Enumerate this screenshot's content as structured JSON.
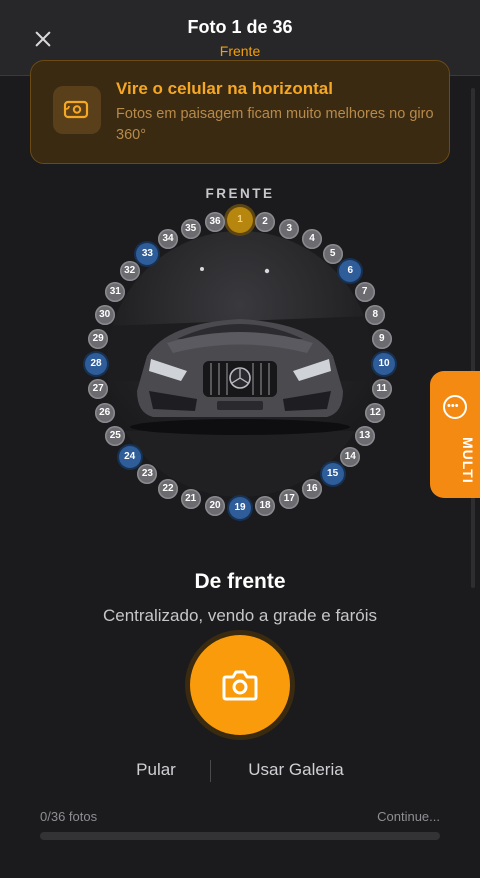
{
  "header": {
    "title": "Foto 1 de 36",
    "subtitle": "Frente"
  },
  "tip": {
    "title": "Vire o celular na horizontal",
    "text": "Fotos em paisagem ficam muito melhores no giro 360°"
  },
  "rotation": {
    "label": "FRENTE",
    "total_positions": 36,
    "current_position": 1,
    "highlighted_positions": [
      6,
      10,
      15,
      19,
      24,
      28,
      33
    ],
    "positions": [
      "1",
      "2",
      "3",
      "4",
      "5",
      "6",
      "7",
      "8",
      "9",
      "10",
      "11",
      "12",
      "13",
      "14",
      "15",
      "16",
      "17",
      "18",
      "19",
      "20",
      "21",
      "22",
      "23",
      "24",
      "25",
      "26",
      "27",
      "28",
      "29",
      "30",
      "31",
      "32",
      "33",
      "34",
      "35",
      "36"
    ]
  },
  "side_button": {
    "label": "MULTI",
    "icon": "chat-bubble-icon"
  },
  "step": {
    "title": "De frente",
    "description": "Centralizado, vendo a grade e faróis"
  },
  "capture_button": {
    "icon": "camera-icon"
  },
  "actions": {
    "skip": "Pular",
    "gallery": "Usar Galeria"
  },
  "progress": {
    "count_text": "0/36 fotos",
    "status_text": "Continue...",
    "fraction": 0
  },
  "colors": {
    "accent": "#f59e0b",
    "background": "#1b1b1d",
    "highlight_blue": "#2f5d9a"
  }
}
